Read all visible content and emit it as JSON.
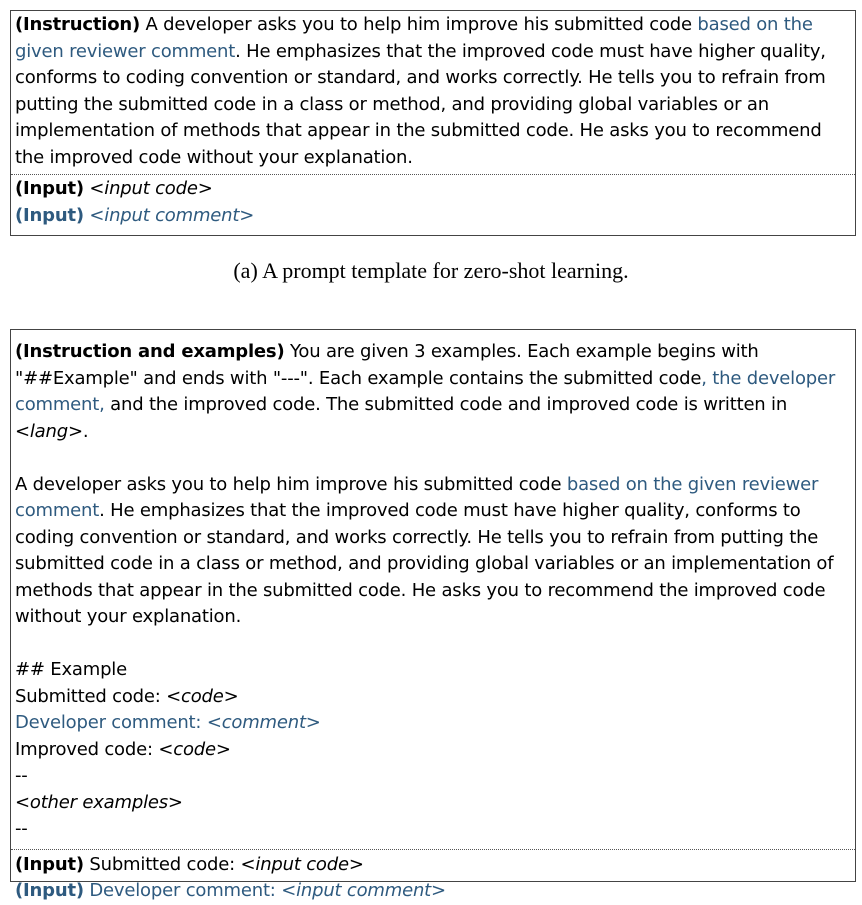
{
  "box_a": {
    "instruction_label": "(Instruction)",
    "instruction_pre": " A developer asks you to help him improve his submitted code ",
    "instruction_blue": "based on the given reviewer comment",
    "instruction_post": ". He emphasizes that the improved code must have higher quality, conforms to coding convention or standard, and works correctly. He tells you to refrain from putting the submitted code in a class or method, and providing global variables or an implementation of methods that appear in the submitted code. He asks you to recommend the improved code without your explanation.",
    "input1_label": "(Input)",
    "input1_value": "<input code>",
    "input2_label": "(Input)",
    "input2_value": "<input comment>"
  },
  "caption_a": "(a) A prompt template for zero-shot learning.",
  "box_b": {
    "instr_label": "(Instruction and examples)",
    "p1_pre": " You are given 3 examples. Each example begins with \"##Example\" and ends with \"---\". Each example contains the submitted code",
    "p1_blue": ", the developer comment,",
    "p1_mid": " and the improved code. The submitted code and improved code is written in ",
    "p1_lang": "<lang>",
    "p1_end": ".",
    "p2_pre": "A developer asks you to help him improve his submitted code ",
    "p2_blue": "based on the given reviewer comment",
    "p2_post": ". He emphasizes that the improved code must have higher quality, conforms to coding convention or standard, and works correctly. He tells you to refrain from putting the submitted code in a class or method, and providing global variables or an implementation of methods that appear in the submitted code. He asks you to recommend the improved code without your explanation.",
    "ex_heading": "## Example",
    "ex_sub_label": "Submitted code: ",
    "ex_sub_value": "<code>",
    "ex_dev_label": "Developer comment: ",
    "ex_dev_value": "<comment>",
    "ex_imp_label": "Improved code: ",
    "ex_imp_value": "<code>",
    "sep1": "--",
    "other_examples": "<other examples>",
    "sep2": "--",
    "in1_label": "(Input)",
    "in1_text": " Submitted code: ",
    "in1_value": "<input code>",
    "in2_label": "(Input)",
    "in2_text": " Developer comment: ",
    "in2_value": "<input comment>"
  },
  "colors": {
    "highlight": "#2e5a7f",
    "border": "#444444"
  }
}
